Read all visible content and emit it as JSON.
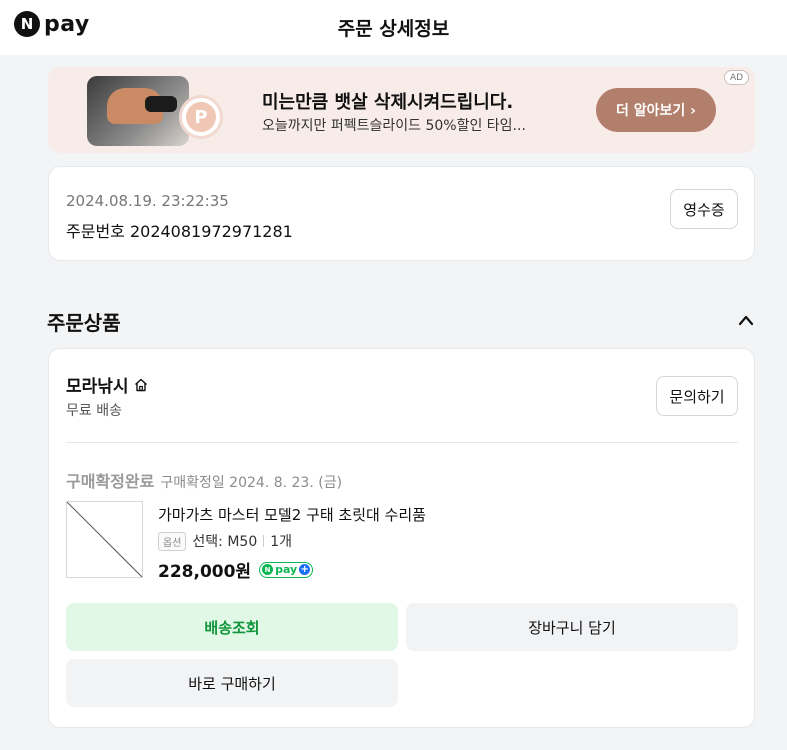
{
  "header": {
    "logo_n": "N",
    "logo_text": "pay",
    "title": "주문 상세정보"
  },
  "ad": {
    "title": "미는만큼 뱃살 삭제시켜드립니다.",
    "subtitle": "오늘까지만 퍼펙트슬라이드 50%할인 타임...",
    "button_label": "더 알아보기 ›",
    "badge": "AD",
    "p_mark": "P"
  },
  "order": {
    "datetime": "2024.08.19. 23:22:35",
    "number_label": "주문번호 2024081972971281",
    "receipt_label": "영수증"
  },
  "section": {
    "title": "주문상품"
  },
  "seller": {
    "name": "모라낚시",
    "shipping": "무료 배송",
    "inquiry_label": "문의하기"
  },
  "item": {
    "status": "구매확정완료",
    "confirm_date": "구매확정일 2024. 8. 23. (금)",
    "name": "가마가츠 마스터 모델2 구태 초릿대 수리품",
    "option_badge": "옵션",
    "option_text": "선택: M50",
    "quantity": "1개",
    "price": "228,000원",
    "npay_n": "N",
    "npay_text": "pay",
    "npay_plus": "+"
  },
  "actions": {
    "track": "배송조회",
    "cart": "장바구니 담기",
    "buy": "바로 구매하기"
  },
  "colors": {
    "accent_green": "#11953c",
    "track_bg": "#e1f8e6",
    "ad_bg": "#f8ece8",
    "ad_button": "#b27f6c"
  }
}
